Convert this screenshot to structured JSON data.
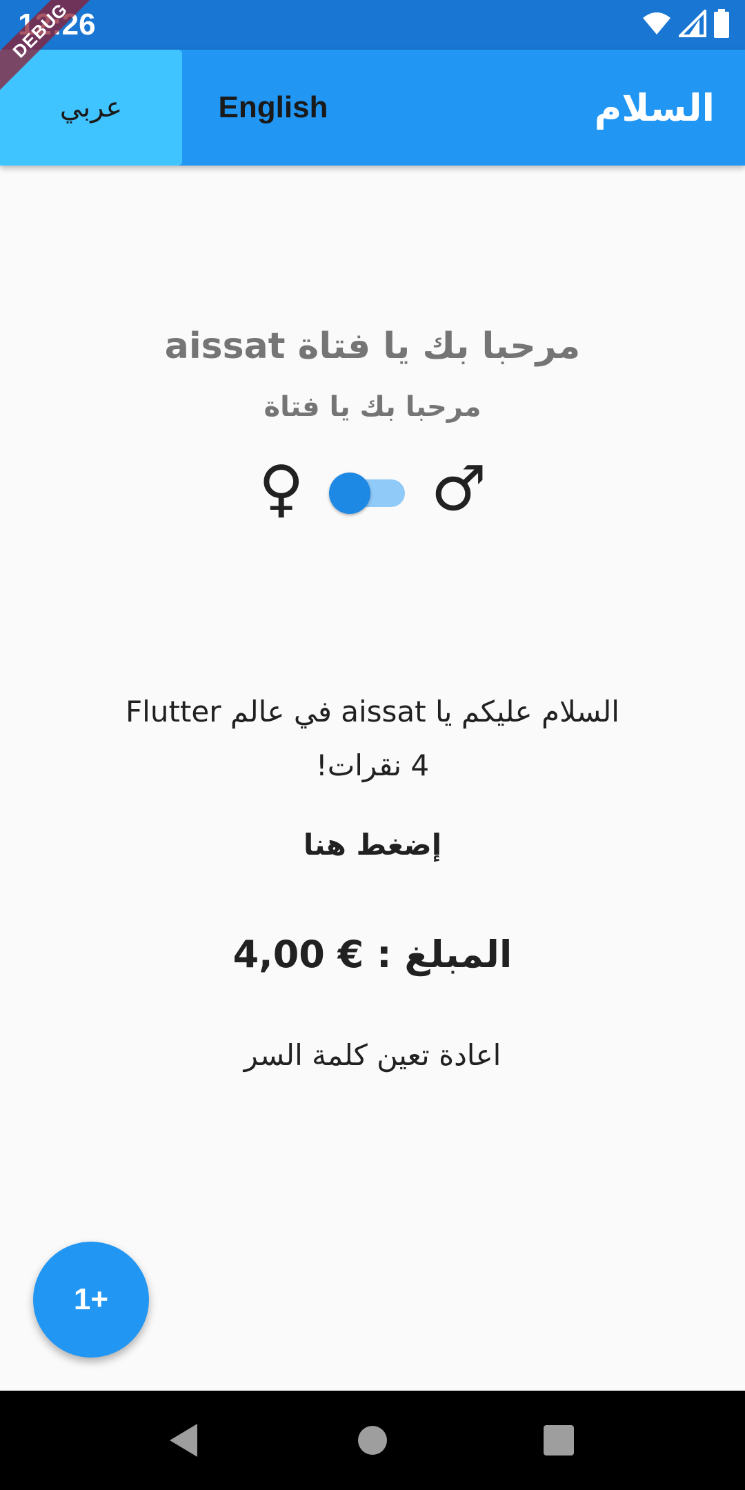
{
  "status_bar": {
    "time": "12:26",
    "icons": [
      "wifi-icon",
      "signal-icon",
      "battery-icon"
    ]
  },
  "debug_banner": "DEBUG",
  "app_bar": {
    "lang_arabic": "عربي",
    "lang_english": "English",
    "title": "السلام"
  },
  "greeting": {
    "title": "aissat مرحبا بك يا فتاة",
    "subtitle": "مرحبا بك يا فتاة",
    "female_symbol": "♀",
    "male_symbol": "♂",
    "switch_on": false
  },
  "content": {
    "welcome": "السلام عليكم يا aissat في عالم Flutter",
    "clicks": "4 نقرات!",
    "press_here": "إضغط هنا",
    "amount": "المبلغ : € 4,00",
    "reset_password": "اعادة تعين كلمة السر"
  },
  "fab": {
    "label": "1+"
  },
  "colors": {
    "primary": "#2196f3",
    "primary_dark": "#1976d2",
    "selected_lang": "#40c4ff",
    "text_grey": "#757575"
  },
  "nav_bar": {
    "buttons": [
      "back-icon",
      "home-icon",
      "recents-icon"
    ]
  }
}
